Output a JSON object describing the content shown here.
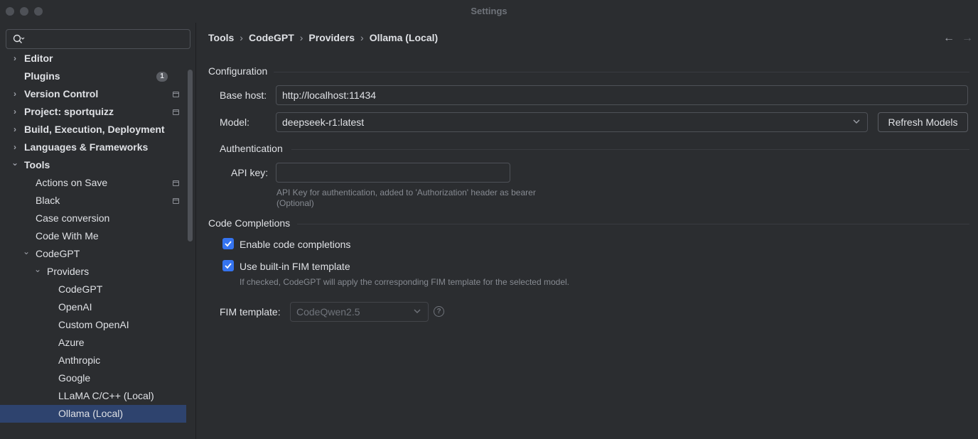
{
  "window": {
    "title": "Settings"
  },
  "search": {
    "placeholder": "",
    "value": ""
  },
  "sidebar": {
    "items": [
      {
        "label": "Editor",
        "bold": true,
        "expand": "collapsed",
        "depth": 0
      },
      {
        "label": "Plugins",
        "bold": true,
        "expand": "none",
        "depth": 0,
        "badge": "1"
      },
      {
        "label": "Version Control",
        "bold": true,
        "expand": "collapsed",
        "depth": 0,
        "project_icon": true
      },
      {
        "label": "Project: sportquizz",
        "bold": true,
        "expand": "collapsed",
        "depth": 0,
        "project_icon": true
      },
      {
        "label": "Build, Execution, Deployment",
        "bold": true,
        "expand": "collapsed",
        "depth": 0
      },
      {
        "label": "Languages & Frameworks",
        "bold": true,
        "expand": "collapsed",
        "depth": 0
      },
      {
        "label": "Tools",
        "bold": true,
        "expand": "expanded",
        "depth": 0
      },
      {
        "label": "Actions on Save",
        "bold": false,
        "expand": "none",
        "depth": 1,
        "project_icon": true
      },
      {
        "label": "Black",
        "bold": false,
        "expand": "none",
        "depth": 1,
        "project_icon": true
      },
      {
        "label": "Case conversion",
        "bold": false,
        "expand": "none",
        "depth": 1
      },
      {
        "label": "Code With Me",
        "bold": false,
        "expand": "none",
        "depth": 1
      },
      {
        "label": "CodeGPT",
        "bold": false,
        "expand": "expanded",
        "depth": 1
      },
      {
        "label": "Providers",
        "bold": false,
        "expand": "expanded",
        "depth": 2
      },
      {
        "label": "CodeGPT",
        "bold": false,
        "expand": "none",
        "depth": 3
      },
      {
        "label": "OpenAI",
        "bold": false,
        "expand": "none",
        "depth": 3
      },
      {
        "label": "Custom OpenAI",
        "bold": false,
        "expand": "none",
        "depth": 3
      },
      {
        "label": "Azure",
        "bold": false,
        "expand": "none",
        "depth": 3
      },
      {
        "label": "Anthropic",
        "bold": false,
        "expand": "none",
        "depth": 3
      },
      {
        "label": "Google",
        "bold": false,
        "expand": "none",
        "depth": 3
      },
      {
        "label": "LLaMA C/C++ (Local)",
        "bold": false,
        "expand": "none",
        "depth": 3
      },
      {
        "label": "Ollama (Local)",
        "bold": false,
        "expand": "none",
        "depth": 3,
        "selected": true
      }
    ]
  },
  "breadcrumb": [
    "Tools",
    "CodeGPT",
    "Providers",
    "Ollama (Local)"
  ],
  "configuration": {
    "title": "Configuration",
    "base_host_label": "Base host:",
    "base_host_value": "http://localhost:11434",
    "model_label": "Model:",
    "model_value": "deepseek-r1:latest",
    "refresh_button": "Refresh Models"
  },
  "authentication": {
    "title": "Authentication",
    "api_key_label": "API key:",
    "api_key_value": "",
    "hint_line1": "API Key for authentication, added to 'Authorization' header as bearer",
    "hint_line2": "(Optional)"
  },
  "code_completions": {
    "title": "Code Completions",
    "enable_label": "Enable code completions",
    "enable_checked": true,
    "fim_builtin_label": "Use built-in FIM template",
    "fim_builtin_checked": true,
    "fim_hint": "If checked, CodeGPT will apply the corresponding FIM template for the selected model.",
    "fim_template_label": "FIM template:",
    "fim_template_value": "CodeQwen2.5"
  },
  "colors": {
    "background": "#2b2d30",
    "selection": "#2e436e",
    "accent": "#3574f0",
    "border": "#4e5157"
  }
}
